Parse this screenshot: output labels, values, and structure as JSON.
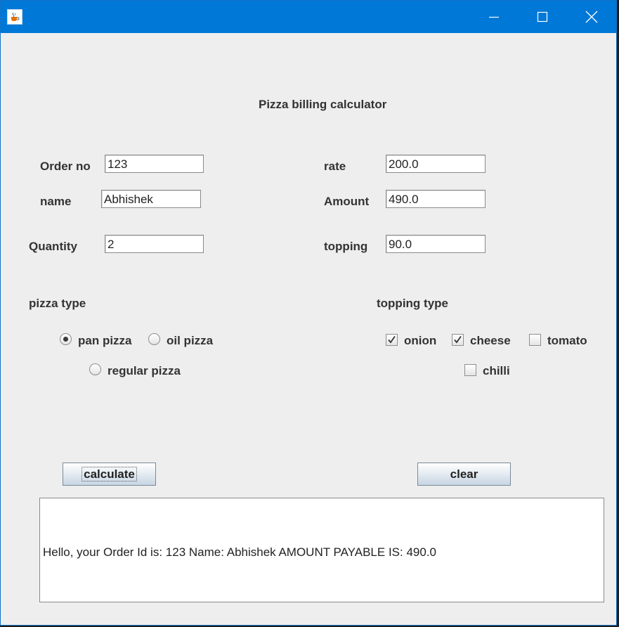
{
  "window": {
    "icon": "java-cup-icon",
    "controls": [
      "minimize-icon",
      "maximize-icon",
      "close-icon"
    ],
    "title_bar_color": "#0078d7"
  },
  "form": {
    "title": "Pizza billing  calculator",
    "order_no_label": "Order no",
    "order_no_value": "123",
    "name_label": "name",
    "name_value": "Abhishek",
    "quantity_label": "Quantity",
    "quantity_value": "2",
    "rate_label": "rate",
    "rate_value": "200.0",
    "amount_label": "Amount",
    "amount_value": "490.0",
    "topping_label": "topping",
    "topping_value": "90.0"
  },
  "pizza_type": {
    "heading": "pizza type",
    "options": [
      {
        "label": "pan pizza",
        "selected": true
      },
      {
        "label": "oil pizza",
        "selected": false
      },
      {
        "label": "regular pizza",
        "selected": false
      }
    ]
  },
  "topping_type": {
    "heading": "topping type",
    "options": [
      {
        "label": "onion",
        "checked": true
      },
      {
        "label": "cheese",
        "checked": true
      },
      {
        "label": "tomato",
        "checked": false
      },
      {
        "label": "chilli",
        "checked": false
      }
    ]
  },
  "buttons": {
    "calculate": "calculate",
    "clear": "clear"
  },
  "output": {
    "text": "Hello, your Order Id is: 123 Name: Abhishek AMOUNT PAYABLE IS: 490.0"
  }
}
